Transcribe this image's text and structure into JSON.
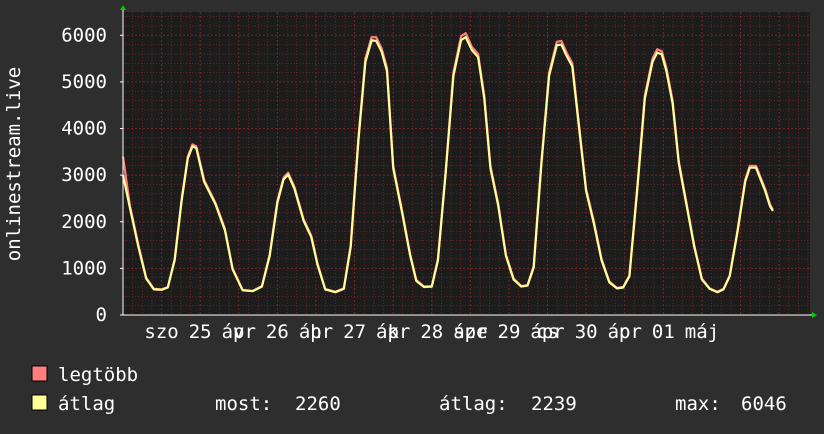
{
  "chart_data": {
    "type": "line",
    "ylabel": "onlinestream.live",
    "ylim": [
      0,
      6500
    ],
    "yticks": [
      0,
      1000,
      2000,
      3000,
      4000,
      5000,
      6000
    ],
    "xlim": [
      0,
      8.9
    ],
    "x_tick_labels": [
      {
        "x": 0.5,
        "label": "szo"
      },
      {
        "x": 1.0,
        "label": "25"
      },
      {
        "x": 1.5,
        "label": "ápr"
      },
      {
        "x": 1.5,
        "label": "v"
      },
      {
        "x": 2.0,
        "label": "26"
      },
      {
        "x": 2.5,
        "label": "ápr"
      },
      {
        "x": 2.5,
        "label": "h"
      },
      {
        "x": 3.0,
        "label": "27"
      },
      {
        "x": 3.5,
        "label": "ápr"
      },
      {
        "x": 3.5,
        "label": "k"
      },
      {
        "x": 4.0,
        "label": "28"
      },
      {
        "x": 4.5,
        "label": "ápr"
      },
      {
        "x": 4.5,
        "label": "sze"
      },
      {
        "x": 5.0,
        "label": "29"
      },
      {
        "x": 5.5,
        "label": "ápr"
      },
      {
        "x": 5.5,
        "label": "cs"
      },
      {
        "x": 6.0,
        "label": "30"
      },
      {
        "x": 6.5,
        "label": "ápr"
      },
      {
        "x": 6.5,
        "label": "p"
      },
      {
        "x": 7.0,
        "label": "01"
      },
      {
        "x": 7.5,
        "label": "máj"
      }
    ],
    "grid": true,
    "series": [
      {
        "name": "legtöbb",
        "color": "#ff7f7f",
        "points": [
          [
            0.0,
            3400
          ],
          [
            0.09,
            2350
          ],
          [
            0.2,
            1500
          ],
          [
            0.3,
            800
          ],
          [
            0.4,
            560
          ],
          [
            0.5,
            550
          ],
          [
            0.58,
            600
          ],
          [
            0.67,
            1200
          ],
          [
            0.76,
            2500
          ],
          [
            0.84,
            3400
          ],
          [
            0.9,
            3660
          ],
          [
            0.95,
            3620
          ],
          [
            1.05,
            2900
          ],
          [
            1.2,
            2400
          ],
          [
            1.32,
            1850
          ],
          [
            1.42,
            1000
          ],
          [
            1.55,
            540
          ],
          [
            1.68,
            520
          ],
          [
            1.8,
            620
          ],
          [
            1.9,
            1300
          ],
          [
            2.0,
            2450
          ],
          [
            2.08,
            2950
          ],
          [
            2.14,
            3050
          ],
          [
            2.22,
            2750
          ],
          [
            2.34,
            2050
          ],
          [
            2.44,
            1700
          ],
          [
            2.52,
            1100
          ],
          [
            2.62,
            560
          ],
          [
            2.75,
            500
          ],
          [
            2.86,
            570
          ],
          [
            2.95,
            1500
          ],
          [
            3.05,
            3800
          ],
          [
            3.14,
            5500
          ],
          [
            3.22,
            5960
          ],
          [
            3.28,
            5960
          ],
          [
            3.35,
            5720
          ],
          [
            3.42,
            5300
          ],
          [
            3.5,
            3200
          ],
          [
            3.62,
            2200
          ],
          [
            3.72,
            1300
          ],
          [
            3.8,
            750
          ],
          [
            3.9,
            610
          ],
          [
            4.0,
            620
          ],
          [
            4.08,
            1200
          ],
          [
            4.18,
            3100
          ],
          [
            4.28,
            5200
          ],
          [
            4.38,
            5980
          ],
          [
            4.44,
            6046
          ],
          [
            4.52,
            5750
          ],
          [
            4.6,
            5600
          ],
          [
            4.68,
            4700
          ],
          [
            4.76,
            3200
          ],
          [
            4.86,
            2400
          ],
          [
            4.96,
            1300
          ],
          [
            5.06,
            780
          ],
          [
            5.16,
            620
          ],
          [
            5.24,
            640
          ],
          [
            5.32,
            1050
          ],
          [
            5.42,
            3300
          ],
          [
            5.52,
            5200
          ],
          [
            5.62,
            5860
          ],
          [
            5.68,
            5880
          ],
          [
            5.74,
            5650
          ],
          [
            5.82,
            5400
          ],
          [
            5.9,
            4200
          ],
          [
            6.0,
            2700
          ],
          [
            6.1,
            2000
          ],
          [
            6.2,
            1200
          ],
          [
            6.3,
            720
          ],
          [
            6.4,
            580
          ],
          [
            6.48,
            600
          ],
          [
            6.56,
            850
          ],
          [
            6.66,
            2700
          ],
          [
            6.76,
            4700
          ],
          [
            6.86,
            5500
          ],
          [
            6.92,
            5700
          ],
          [
            6.98,
            5660
          ],
          [
            7.04,
            5300
          ],
          [
            7.12,
            4600
          ],
          [
            7.2,
            3300
          ],
          [
            7.3,
            2400
          ],
          [
            7.4,
            1500
          ],
          [
            7.5,
            780
          ],
          [
            7.6,
            570
          ],
          [
            7.7,
            500
          ],
          [
            7.78,
            560
          ],
          [
            7.86,
            850
          ],
          [
            7.96,
            1800
          ],
          [
            8.06,
            2900
          ],
          [
            8.12,
            3200
          ],
          [
            8.2,
            3200
          ],
          [
            8.26,
            2950
          ],
          [
            8.32,
            2700
          ],
          [
            8.38,
            2380
          ],
          [
            8.42,
            2260
          ]
        ]
      },
      {
        "name": "átlag",
        "color": "#ffff99",
        "points": [
          [
            0.0,
            3000
          ],
          [
            0.09,
            2300
          ],
          [
            0.2,
            1460
          ],
          [
            0.3,
            780
          ],
          [
            0.4,
            550
          ],
          [
            0.5,
            540
          ],
          [
            0.58,
            590
          ],
          [
            0.67,
            1180
          ],
          [
            0.76,
            2460
          ],
          [
            0.84,
            3360
          ],
          [
            0.9,
            3620
          ],
          [
            0.95,
            3580
          ],
          [
            1.05,
            2860
          ],
          [
            1.2,
            2370
          ],
          [
            1.32,
            1820
          ],
          [
            1.42,
            980
          ],
          [
            1.55,
            530
          ],
          [
            1.68,
            510
          ],
          [
            1.8,
            610
          ],
          [
            1.9,
            1270
          ],
          [
            2.0,
            2410
          ],
          [
            2.08,
            2910
          ],
          [
            2.14,
            3010
          ],
          [
            2.22,
            2710
          ],
          [
            2.34,
            2020
          ],
          [
            2.44,
            1670
          ],
          [
            2.52,
            1080
          ],
          [
            2.62,
            550
          ],
          [
            2.75,
            490
          ],
          [
            2.86,
            560
          ],
          [
            2.95,
            1460
          ],
          [
            3.05,
            3740
          ],
          [
            3.14,
            5430
          ],
          [
            3.22,
            5890
          ],
          [
            3.28,
            5880
          ],
          [
            3.35,
            5650
          ],
          [
            3.42,
            5230
          ],
          [
            3.5,
            3150
          ],
          [
            3.62,
            2160
          ],
          [
            3.72,
            1270
          ],
          [
            3.8,
            730
          ],
          [
            3.9,
            600
          ],
          [
            4.0,
            610
          ],
          [
            4.08,
            1170
          ],
          [
            4.18,
            3050
          ],
          [
            4.28,
            5130
          ],
          [
            4.38,
            5900
          ],
          [
            4.44,
            5960
          ],
          [
            4.52,
            5680
          ],
          [
            4.6,
            5530
          ],
          [
            4.68,
            4640
          ],
          [
            4.76,
            3150
          ],
          [
            4.86,
            2360
          ],
          [
            4.96,
            1270
          ],
          [
            5.06,
            760
          ],
          [
            5.16,
            610
          ],
          [
            5.24,
            630
          ],
          [
            5.32,
            1020
          ],
          [
            5.42,
            3240
          ],
          [
            5.52,
            5130
          ],
          [
            5.62,
            5790
          ],
          [
            5.68,
            5800
          ],
          [
            5.74,
            5580
          ],
          [
            5.82,
            5330
          ],
          [
            5.9,
            4140
          ],
          [
            6.0,
            2660
          ],
          [
            6.1,
            1960
          ],
          [
            6.2,
            1170
          ],
          [
            6.3,
            700
          ],
          [
            6.4,
            570
          ],
          [
            6.48,
            590
          ],
          [
            6.56,
            830
          ],
          [
            6.66,
            2650
          ],
          [
            6.76,
            4640
          ],
          [
            6.86,
            5430
          ],
          [
            6.92,
            5630
          ],
          [
            6.98,
            5590
          ],
          [
            7.04,
            5230
          ],
          [
            7.12,
            4540
          ],
          [
            7.2,
            3250
          ],
          [
            7.3,
            2360
          ],
          [
            7.4,
            1470
          ],
          [
            7.5,
            760
          ],
          [
            7.6,
            560
          ],
          [
            7.7,
            490
          ],
          [
            7.78,
            550
          ],
          [
            7.86,
            830
          ],
          [
            7.96,
            1770
          ],
          [
            8.06,
            2860
          ],
          [
            8.12,
            3160
          ],
          [
            8.2,
            3160
          ],
          [
            8.26,
            2910
          ],
          [
            8.32,
            2660
          ],
          [
            8.38,
            2340
          ],
          [
            8.42,
            2230
          ]
        ]
      }
    ],
    "stats": [
      {
        "label": "most:",
        "value": "2260"
      },
      {
        "label": "átlag:",
        "value": "2239"
      },
      {
        "label": "max:",
        "value": "6046"
      }
    ]
  },
  "colors": {
    "background": "#2e2e2e",
    "plot_background": "#1c1c1c",
    "grid_minor": "#8a2a2a",
    "grid_major": "#7a2525",
    "axis": "#ffffff",
    "arrow": "#00cc00"
  }
}
